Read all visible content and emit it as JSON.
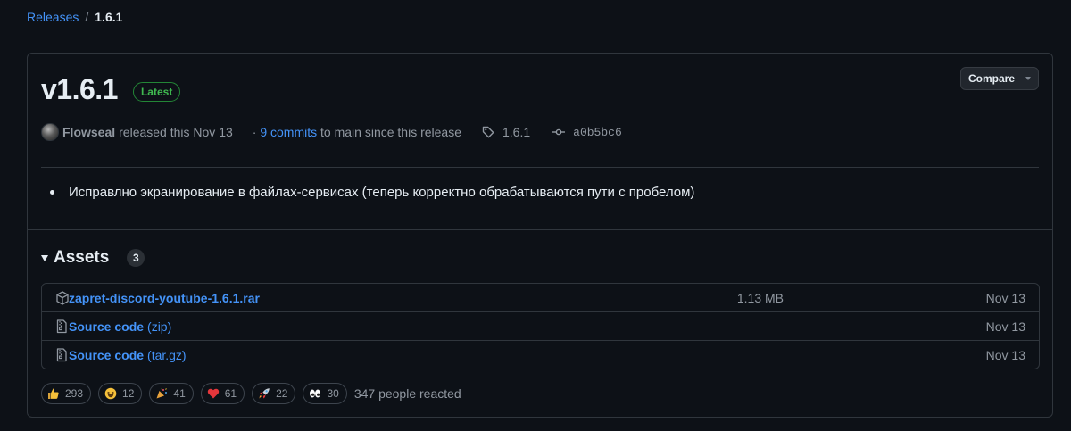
{
  "breadcrumb": {
    "releases": "Releases",
    "separator": "/",
    "current": "1.6.1"
  },
  "release": {
    "title": "v1.6.1",
    "latest_badge": "Latest",
    "compare_label": "Compare",
    "author": "Flowseal",
    "released_text": "released this Nov 13",
    "commits_prefix": "·",
    "commits_link": "9 commits",
    "commits_suffix": "to main since this release",
    "tag": "1.6.1",
    "commit_hash": "a0b5bc6",
    "notes": [
      "Исправлно экранирование в файлах-сервисах (теперь корректно обрабатываются пути с пробелом)"
    ]
  },
  "assets": {
    "title": "Assets",
    "count": "3",
    "items": [
      {
        "name": "zapret-discord-youtube-1.6.1.rar",
        "sub": "",
        "size": "1.13 MB",
        "date": "Nov 13",
        "icon": "package-icon"
      },
      {
        "name": "Source code",
        "sub": "(zip)",
        "size": "",
        "date": "Nov 13",
        "icon": "file-zip-icon"
      },
      {
        "name": "Source code",
        "sub": "(tar.gz)",
        "size": "",
        "date": "Nov 13",
        "icon": "file-zip-icon"
      }
    ]
  },
  "reactions": {
    "items": [
      {
        "emoji": "thumbs-up",
        "count": "293"
      },
      {
        "emoji": "laugh",
        "count": "12"
      },
      {
        "emoji": "hooray",
        "count": "41"
      },
      {
        "emoji": "heart",
        "count": "61"
      },
      {
        "emoji": "rocket",
        "count": "22"
      },
      {
        "emoji": "eyes",
        "count": "30"
      }
    ],
    "total_text": "347 people reacted"
  },
  "colors": {
    "background": "#0d1117",
    "border": "#30363d",
    "link": "#4493f8",
    "muted": "#9198a1",
    "latest_green": "#3fb950"
  }
}
